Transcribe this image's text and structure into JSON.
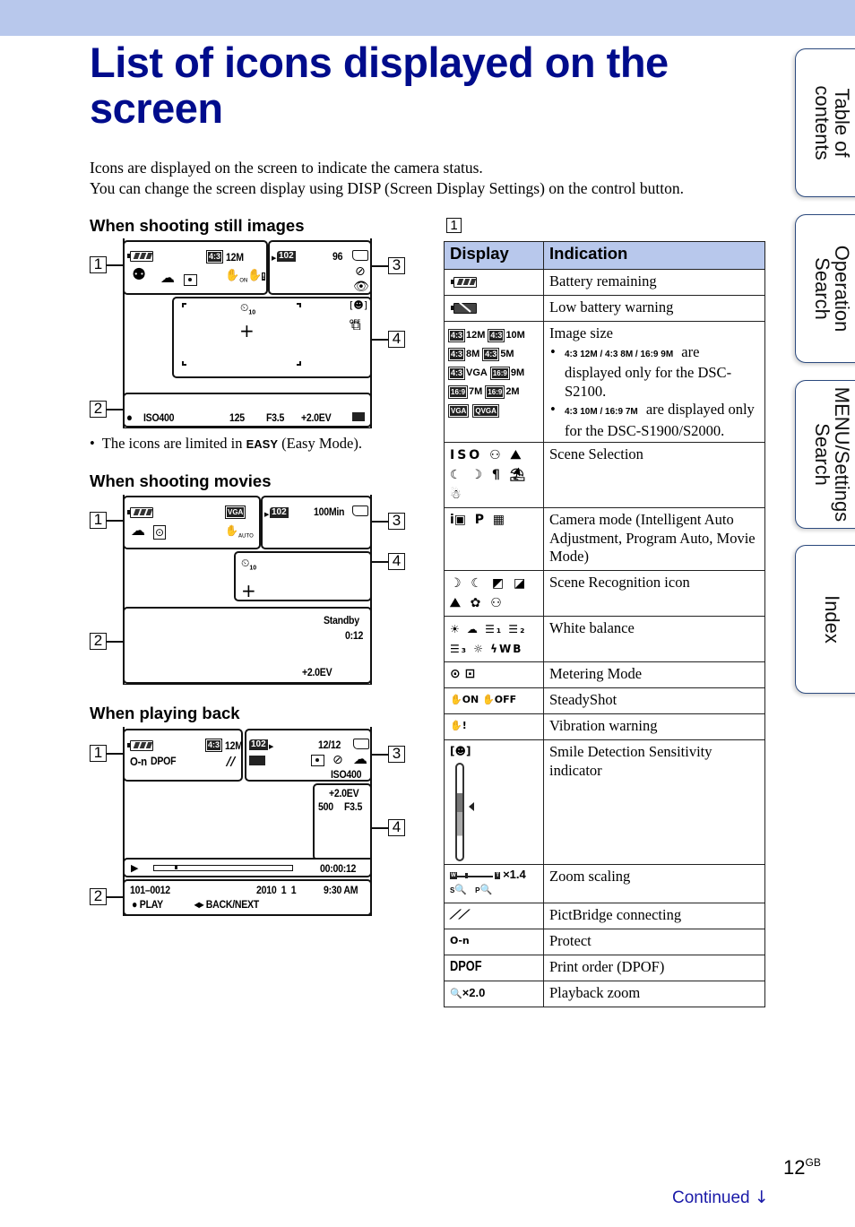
{
  "page": {
    "title": "List of icons displayed on the screen",
    "intro_lines": [
      "Icons are displayed on the screen to indicate the camera status.",
      "You can change the screen display using DISP (Screen Display Settings) on the control button."
    ],
    "page_number": "12",
    "page_suffix": "GB",
    "continued_label": "Continued",
    "continued_icon": "arrow-down",
    "colors": {
      "accent_bar": "#b8c8ec",
      "title": "#000c8c",
      "link": "#1a1aa8",
      "tab_border": "#2c4a7e"
    }
  },
  "side_tabs": [
    {
      "label": "Table of contents"
    },
    {
      "label": "Operation Search"
    },
    {
      "label": "MENU/Settings Search"
    },
    {
      "label": "Index"
    }
  ],
  "still": {
    "heading": "When shooting still images",
    "callouts": [
      "1",
      "2",
      "3",
      "4"
    ],
    "area1": {
      "battery_icon": "battery-full",
      "ratio": "4:3",
      "size": "12M",
      "icons": [
        "scene-soft-snap-icon",
        "white-balance-cloudy-icon",
        "metering-spot-icon",
        "steadyshot-on-icon",
        "vibration-warning-icon"
      ],
      "steadyshot_label": "ON"
    },
    "area3": {
      "folder": "102",
      "count": "96",
      "icons": [
        "memory-card-icon",
        "flash-off-icon",
        "red-eye-icon"
      ]
    },
    "area4": {
      "timer_label": "10",
      "smile_off": "OFF",
      "icons": [
        "self-timer-icon",
        "smile-shutter-off-icon",
        "burst-icon",
        "af-frame",
        "spot-meter-crosshair"
      ]
    },
    "area2": {
      "rec": "●",
      "iso": "ISO400",
      "shutter": "125",
      "aperture": "F3.5",
      "ev": "+2.0EV",
      "histogram_icon": "[ ]"
    },
    "note_prefix": "The icons are limited in",
    "note_easy": "EASY",
    "note_suffix": "(Easy Mode)."
  },
  "movie": {
    "heading": "When shooting movies",
    "callouts": [
      "1",
      "2",
      "3",
      "4"
    ],
    "area1": {
      "battery_icon": "battery-full",
      "movie_size": "VGA",
      "icons": [
        "white-balance-cloudy-icon",
        "metering-multi-icon",
        "steadyshot-auto-icon"
      ],
      "steadyshot_label": "AUTO"
    },
    "area3": {
      "folder": "102",
      "remaining": "100Min",
      "icons": [
        "memory-card-icon"
      ]
    },
    "area4": {
      "timer_label": "10",
      "icons": [
        "self-timer-icon",
        "spot-meter-crosshair"
      ]
    },
    "area2": {
      "status": "Standby",
      "time": "0:12",
      "ev": "+2.0EV"
    }
  },
  "playback": {
    "heading": "When playing back",
    "callouts": [
      "1",
      "2",
      "3",
      "4"
    ],
    "area1": {
      "battery_icon": "battery-full",
      "ratio": "4:3",
      "size": "12M",
      "protect": "O-n",
      "dpof": "DPOF",
      "icons": [
        "protect-icon",
        "pictbridge-icon"
      ]
    },
    "area3": {
      "folder": "102",
      "counter": "12/12",
      "iso": "ISO400",
      "icons": [
        "memory-card-icon",
        "play-folder-icon",
        "histogram-icon",
        "metering-spot-icon",
        "flash-off-icon",
        "white-balance-cloudy-icon"
      ]
    },
    "area4": {
      "ev": "+2.0EV",
      "shutter": "500",
      "aperture": "F3.5",
      "elapsed": "00:00:12",
      "progress": 0.15
    },
    "area2": {
      "file": "101–0012",
      "date": "2010  1  1",
      "time": "9:30 AM",
      "play_label": "● PLAY",
      "nav_label": "◂▸ BACK/NEXT"
    }
  },
  "table": {
    "section_label": "1",
    "headers": [
      "Display",
      "Indication"
    ],
    "rows": [
      {
        "display": [
          "battery-remaining-icon"
        ],
        "indication": "Battery remaining"
      },
      {
        "display": [
          "low-battery-icon"
        ],
        "indication": "Low battery warning"
      },
      {
        "display_sizes": [
          {
            "r": "4:3",
            "s": "12M"
          },
          {
            "r": "4:3",
            "s": "10M"
          },
          {
            "r": "4:3",
            "s": "8M"
          },
          {
            "r": "4:3",
            "s": "5M"
          },
          {
            "r": "4:3",
            "s": "VGA"
          },
          {
            "r": "16:9",
            "s": "9M"
          },
          {
            "r": "16:9",
            "s": "7M"
          },
          {
            "r": "16:9",
            "s": "2M"
          },
          {
            "r": "",
            "s": "VGA"
          },
          {
            "r": "",
            "s": "QVGA"
          }
        ],
        "indication": "Image size",
        "bullets": [
          {
            "icons": "4:3 12M / 4:3 8M / 16:9 9M",
            "text": "are displayed only for the DSC-S2100."
          },
          {
            "icons": "4:3 10M / 16:9 7M",
            "text": "are displayed only for the DSC-S1900/S2000."
          }
        ]
      },
      {
        "display": [
          "high-sensitivity-icon",
          "soft-snap-icon",
          "landscape-icon",
          "twilight-portrait-icon",
          "twilight-icon",
          "gourmet-icon",
          "beach-icon",
          "snow-icon"
        ],
        "display_glyphs": "ISO ⚇ ⛰ ☾ ☽ ¶ ⛱ ☃",
        "indication": "Scene Selection"
      },
      {
        "display": [
          "intelligent-auto-icon",
          "program-auto-icon",
          "movie-mode-icon"
        ],
        "display_glyphs": "i▣  P  ▦",
        "indication": "Camera mode (Intelligent Auto Adjustment, Program Auto, Movie Mode)"
      },
      {
        "display": [
          "twilight-icon",
          "twilight-portrait-icon",
          "twilight-tripod-icon",
          "backlight-portrait-icon",
          "landscape-icon",
          "macro-icon",
          "portrait-icon"
        ],
        "display_glyphs": "☽ ☾ ◩ ◪ ⛰ ✿ ⚇",
        "indication": "Scene Recognition icon"
      },
      {
        "display": [
          "wb-daylight-icon",
          "wb-cloudy-icon",
          "wb-fluorescent-1-icon",
          "wb-fluorescent-2-icon",
          "wb-fluorescent-3-icon",
          "wb-incandescent-icon",
          "wb-flash-icon"
        ],
        "display_glyphs": "☀ ☁ ☰₁ ☰₂ ☰₃ ☼ ϟWB",
        "indication": "White balance"
      },
      {
        "display": [
          "metering-multi-icon",
          "metering-spot-icon"
        ],
        "display_glyphs": "⊙ ⊡",
        "indication": "Metering Mode"
      },
      {
        "display": [
          "steadyshot-on-icon",
          "steadyshot-off-icon"
        ],
        "display_glyphs": "✋ON ✋OFF",
        "indication": "SteadyShot"
      },
      {
        "display": [
          "vibration-warning-icon"
        ],
        "display_glyphs": "✋!",
        "indication": "Vibration warning"
      },
      {
        "display": [
          "smile-sensitivity-icon",
          "smile-sensitivity-bar"
        ],
        "display_glyphs": "[☻]",
        "indication": "Smile Detection Sensitivity indicator"
      },
      {
        "display": [
          "zoom-bar",
          "smart-zoom-icon",
          "precision-zoom-icon"
        ],
        "zoom_value": "×1.4",
        "zoom_w": "W",
        "zoom_t": "T",
        "zoom_s": "S",
        "zoom_p": "P",
        "indication": "Zoom scaling"
      },
      {
        "display": [
          "pictbridge-icon"
        ],
        "display_glyphs": "⟋⟋",
        "indication": "PictBridge connecting"
      },
      {
        "display": [
          "protect-icon"
        ],
        "display_glyphs": "O‑n",
        "indication": "Protect"
      },
      {
        "display": [
          "dpof-icon"
        ],
        "display_glyphs": "DPOF",
        "indication": "Print order (DPOF)"
      },
      {
        "display": [
          "playback-zoom-icon"
        ],
        "display_glyphs": "🔍×2.0",
        "zoom_label": "×2.0",
        "indication": "Playback zoom"
      }
    ]
  }
}
